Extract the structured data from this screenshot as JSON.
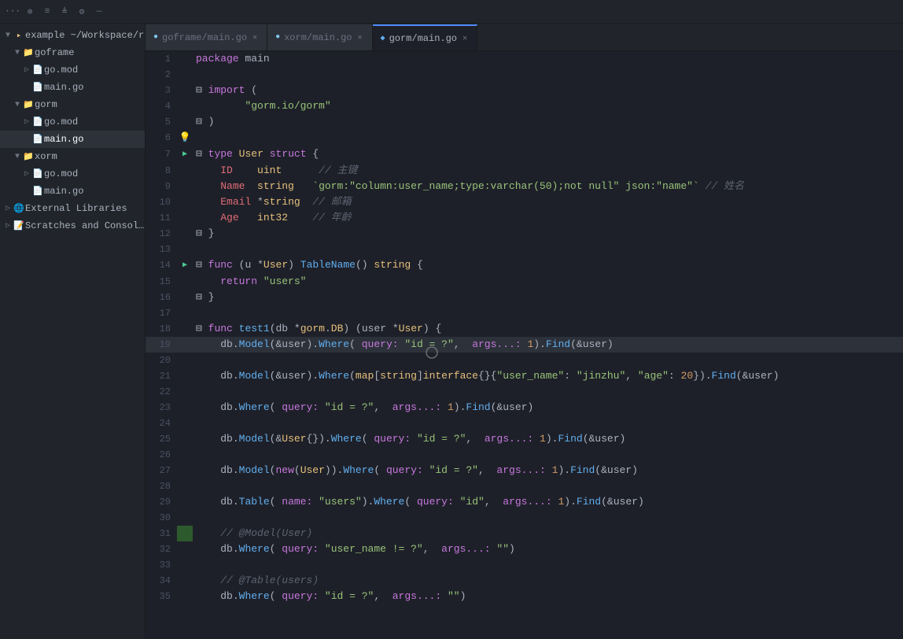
{
  "toolbar": {
    "icons": [
      "...",
      "⊕",
      "≡",
      "≜",
      "⚙",
      "—"
    ]
  },
  "tabs": [
    {
      "label": "goframe/main.go",
      "active": false
    },
    {
      "label": "xorm/main.go",
      "active": false
    },
    {
      "label": "gorm/main.go",
      "active": true
    }
  ],
  "sidebar": {
    "title": "example ~/Workspace/r",
    "items": [
      {
        "indent": 0,
        "arrow": "▼",
        "icon": "📁",
        "label": "example ~/Workspace/r",
        "type": "root"
      },
      {
        "indent": 1,
        "arrow": "▼",
        "icon": "📁",
        "label": "goframe",
        "type": "folder"
      },
      {
        "indent": 2,
        "arrow": "▷",
        "icon": "📄",
        "label": "go.mod",
        "type": "mod"
      },
      {
        "indent": 2,
        "arrow": "",
        "icon": "📄",
        "label": "main.go",
        "type": "go"
      },
      {
        "indent": 1,
        "arrow": "▼",
        "icon": "📁",
        "label": "gorm",
        "type": "folder"
      },
      {
        "indent": 2,
        "arrow": "▷",
        "icon": "📄",
        "label": "go.mod",
        "type": "mod"
      },
      {
        "indent": 2,
        "arrow": "",
        "icon": "📄",
        "label": "main.go",
        "type": "go",
        "selected": true
      },
      {
        "indent": 1,
        "arrow": "▼",
        "icon": "📁",
        "label": "xorm",
        "type": "folder"
      },
      {
        "indent": 2,
        "arrow": "▷",
        "icon": "📄",
        "label": "go.mod",
        "type": "mod"
      },
      {
        "indent": 2,
        "arrow": "",
        "icon": "📄",
        "label": "main.go",
        "type": "go"
      },
      {
        "indent": 0,
        "arrow": "▷",
        "icon": "🌐",
        "label": "External Libraries",
        "type": "external"
      },
      {
        "indent": 0,
        "arrow": "▷",
        "icon": "📝",
        "label": "Scratches and Consoles",
        "type": "scratch"
      }
    ]
  },
  "lines": [
    {
      "num": 1,
      "gutter": "",
      "code": "package_main"
    },
    {
      "num": 2,
      "gutter": "",
      "code": ""
    },
    {
      "num": 3,
      "gutter": "",
      "code": "import_("
    },
    {
      "num": 4,
      "gutter": "",
      "code": "    str_gorm.io/gorm"
    },
    {
      "num": 5,
      "gutter": "",
      "code": ")"
    },
    {
      "num": 6,
      "gutter": "💡",
      "code": ""
    },
    {
      "num": 7,
      "gutter": "▶",
      "code": "type_User_struct_{"
    },
    {
      "num": 8,
      "gutter": "",
      "code": "    ID    uint      // 主键"
    },
    {
      "num": 9,
      "gutter": "",
      "code": "    Name  string   `gorm:\"column:user_name;type:varchar(50);not null\" json:\"name\"` // 姓名"
    },
    {
      "num": 10,
      "gutter": "",
      "code": "    Email *string  // 邮箱"
    },
    {
      "num": 11,
      "gutter": "",
      "code": "    Age   int32    // 年齡"
    },
    {
      "num": 12,
      "gutter": "",
      "code": "}"
    },
    {
      "num": 13,
      "gutter": "",
      "code": ""
    },
    {
      "num": 14,
      "gutter": "▶",
      "code": "func_(u_*User)_TableName()_string_{"
    },
    {
      "num": 15,
      "gutter": "",
      "code": "    return_\"users\""
    },
    {
      "num": 16,
      "gutter": "",
      "code": "}"
    },
    {
      "num": 17,
      "gutter": "",
      "code": ""
    },
    {
      "num": 18,
      "gutter": "",
      "code": "func_test1(db_*gorm.DB)_(user_*User)_{"
    },
    {
      "num": 19,
      "gutter": "",
      "code": "    db.Model(&user).Where(_query:_\"id_=_?\",__args...:_1).Find(&user)"
    },
    {
      "num": 20,
      "gutter": "",
      "code": ""
    },
    {
      "num": 21,
      "gutter": "",
      "code": "    db.Model(&user).Where(map[string]interface{}{\"user_name\":_\"jinzhu\",_\"age\":_20}).Find(&user)"
    },
    {
      "num": 22,
      "gutter": "",
      "code": ""
    },
    {
      "num": 23,
      "gutter": "",
      "code": "    db.Where(_query:_\"id_=_?\",__args...:_1).Find(&user)"
    },
    {
      "num": 24,
      "gutter": "",
      "code": ""
    },
    {
      "num": 25,
      "gutter": "",
      "code": "    db.Model(&User{}).Where(_query:_\"id_=_?\",__args...:_1).Find(&user)"
    },
    {
      "num": 26,
      "gutter": "",
      "code": ""
    },
    {
      "num": 27,
      "gutter": "",
      "code": "    db.Model(new(User)).Where(_query:_\"id_=_?\",__args...:_1).Find(&user)"
    },
    {
      "num": 28,
      "gutter": "",
      "code": ""
    },
    {
      "num": 29,
      "gutter": "",
      "code": "    db.Table(_name:_\"users\").Where(_query:_\"id\",__args...:_1).Find(&user)"
    },
    {
      "num": 30,
      "gutter": "",
      "code": ""
    },
    {
      "num": 31,
      "gutter": "",
      "code": "    //_@Model(User)"
    },
    {
      "num": 32,
      "gutter": "",
      "code": "    db.Where(_query:_\"user_name_!=_?\",__args...:_\"\")"
    },
    {
      "num": 33,
      "gutter": "",
      "code": ""
    },
    {
      "num": 34,
      "gutter": "",
      "code": "    //_@Table(users)"
    },
    {
      "num": 35,
      "gutter": "",
      "code": "    db.Where(_query:_\"id_=_?\",__args...:_\"\")"
    }
  ]
}
